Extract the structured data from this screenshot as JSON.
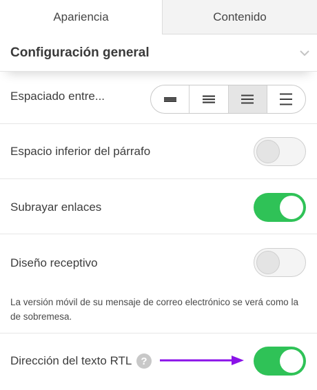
{
  "tabs": [
    {
      "label": "Apariencia",
      "active": true
    },
    {
      "label": "Contenido",
      "active": false
    }
  ],
  "section": {
    "title": "Configuración general",
    "icon": "chevron-down-icon"
  },
  "spacing": {
    "label": "Espaciado entre...",
    "options": [
      "spacing-tight-icon",
      "spacing-compact-icon",
      "spacing-normal-icon",
      "spacing-wide-icon"
    ],
    "selected_index": 2
  },
  "paragraph_spacing": {
    "label": "Espacio inferior del párrafo",
    "on": false
  },
  "underline_links": {
    "label": "Subrayar enlaces",
    "on": true
  },
  "responsive": {
    "label": "Diseño receptivo",
    "on": false,
    "note": "La versión móvil de su mensaje de correo electrónico se verá como la de sobremesa."
  },
  "rtl": {
    "label": "Dirección del texto RTL",
    "on": true,
    "help": "?"
  },
  "colors": {
    "toggle_on": "#2fc257",
    "annotation_arrow": "#8a12e8"
  }
}
